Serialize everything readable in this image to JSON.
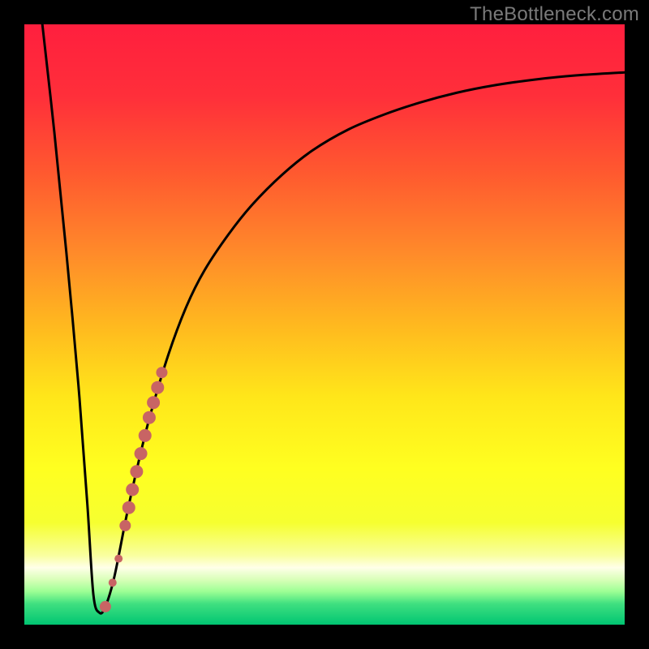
{
  "watermark": "TheBottleneck.com",
  "chart_data": {
    "type": "line",
    "title": "",
    "xlabel": "",
    "ylabel": "",
    "xlim": [
      0,
      100
    ],
    "ylim": [
      0,
      100
    ],
    "curve": {
      "name": "bottleneck-curve",
      "x": [
        3,
        5,
        7,
        9,
        10.5,
        11.5,
        12.5,
        13.5,
        15,
        17,
        19,
        21,
        24,
        27,
        30,
        34,
        38,
        43,
        48,
        54,
        60,
        66,
        72,
        78,
        85,
        92,
        100
      ],
      "y": [
        100,
        82,
        62,
        40,
        20,
        5,
        2,
        3,
        8,
        18,
        27,
        35,
        45,
        53,
        59,
        65,
        70,
        75,
        79,
        82.5,
        85,
        87,
        88.6,
        89.8,
        90.8,
        91.5,
        92
      ]
    },
    "highlight_points": {
      "name": "highlighted-dots",
      "color": "#c86464",
      "points": [
        {
          "x": 13.5,
          "y": 3,
          "r": 7
        },
        {
          "x": 14.7,
          "y": 7,
          "r": 5
        },
        {
          "x": 15.7,
          "y": 11,
          "r": 5
        },
        {
          "x": 16.8,
          "y": 16.5,
          "r": 7
        },
        {
          "x": 17.4,
          "y": 19.5,
          "r": 8
        },
        {
          "x": 18.0,
          "y": 22.5,
          "r": 8
        },
        {
          "x": 18.7,
          "y": 25.5,
          "r": 8
        },
        {
          "x": 19.4,
          "y": 28.5,
          "r": 8
        },
        {
          "x": 20.1,
          "y": 31.5,
          "r": 8
        },
        {
          "x": 20.8,
          "y": 34.5,
          "r": 8
        },
        {
          "x": 21.5,
          "y": 37,
          "r": 8
        },
        {
          "x": 22.2,
          "y": 39.5,
          "r": 8
        },
        {
          "x": 22.9,
          "y": 42,
          "r": 7
        }
      ]
    },
    "gradient_stops": [
      {
        "offset": 0.0,
        "color": "#ff1f3e"
      },
      {
        "offset": 0.12,
        "color": "#ff2f3a"
      },
      {
        "offset": 0.25,
        "color": "#ff5a2f"
      },
      {
        "offset": 0.38,
        "color": "#ff8a2a"
      },
      {
        "offset": 0.5,
        "color": "#ffb81f"
      },
      {
        "offset": 0.62,
        "color": "#ffe61a"
      },
      {
        "offset": 0.74,
        "color": "#ffff20"
      },
      {
        "offset": 0.83,
        "color": "#f6ff30"
      },
      {
        "offset": 0.885,
        "color": "#f9ffa0"
      },
      {
        "offset": 0.905,
        "color": "#ffffe8"
      },
      {
        "offset": 0.925,
        "color": "#d8ffb8"
      },
      {
        "offset": 0.945,
        "color": "#9cff94"
      },
      {
        "offset": 0.965,
        "color": "#40e080"
      },
      {
        "offset": 1.0,
        "color": "#00c572"
      }
    ]
  }
}
